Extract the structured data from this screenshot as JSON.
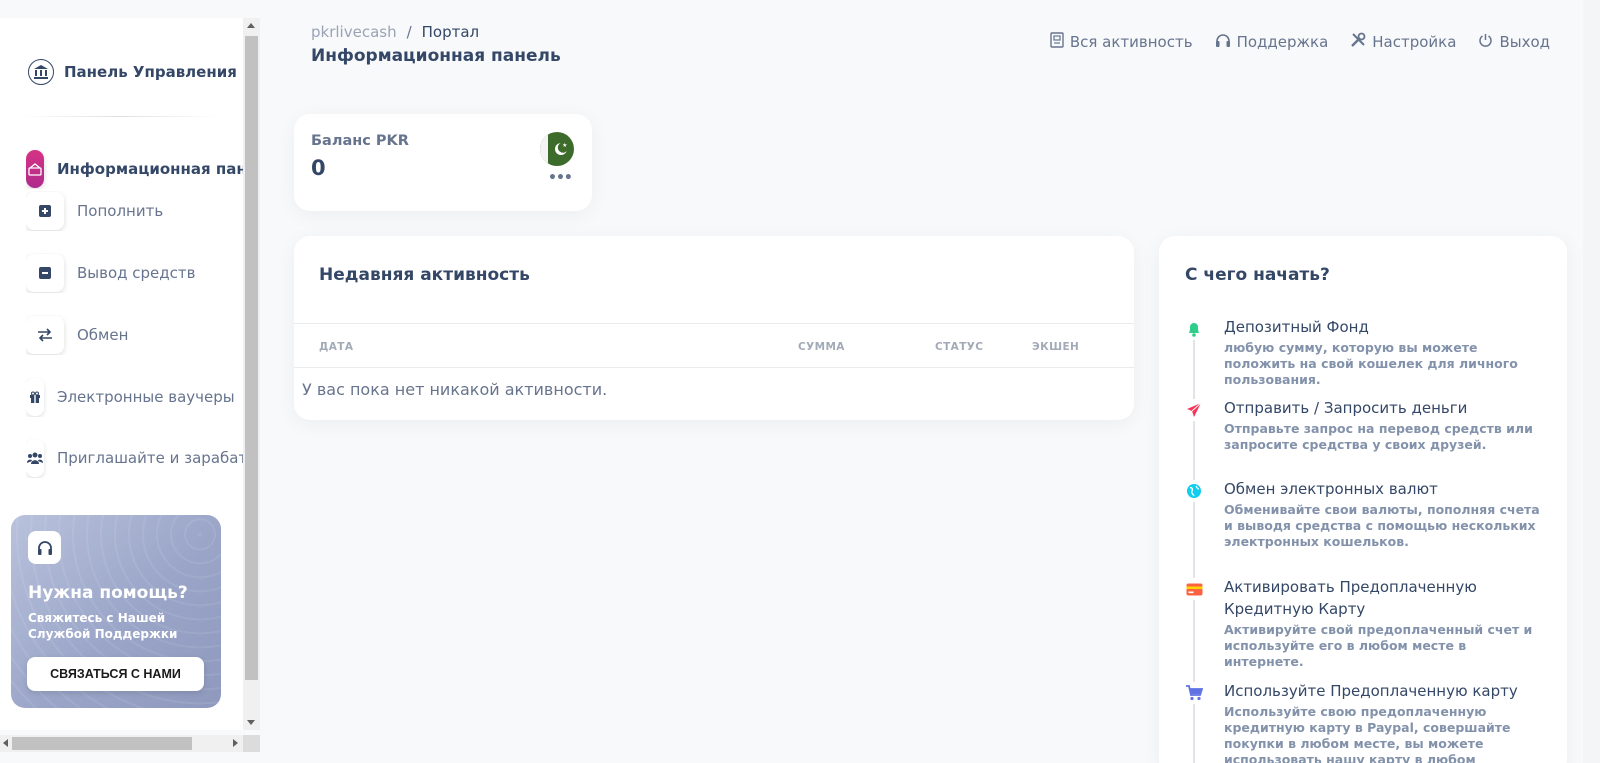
{
  "sidebar": {
    "brand": "Панель Управления pkrlivecash",
    "items": [
      {
        "label": "Информационная панель"
      },
      {
        "label": "Пополнить"
      },
      {
        "label": "Вывод средств"
      },
      {
        "label": "Обмен"
      },
      {
        "label": "Электронные ваучеры"
      },
      {
        "label": "Приглашайте и зарабатывайте"
      }
    ],
    "help": {
      "title": "Нужна помощь?",
      "subtitle": "Свяжитесь с Нашей Службой Поддержки",
      "button": "СВЯЗАТЬСЯ С НАМИ"
    }
  },
  "header": {
    "breadcrumb_root": "pkrlivecash",
    "breadcrumb_sep": "/",
    "breadcrumb_current": "Портал",
    "title": "Информационная панель",
    "nav": {
      "activity": "Вся активность",
      "support": "Поддержка",
      "settings": "Настройка",
      "logout": "Выход"
    }
  },
  "balance": {
    "label": "Баланс PKR",
    "value": "0",
    "more": "•••"
  },
  "activity": {
    "title": "Недавняя активность",
    "columns": [
      "ДАТА",
      "СУММА",
      "СТАТУС",
      "ЭКШЕН"
    ],
    "empty": "У вас пока нет никакой активности."
  },
  "getting_started": {
    "title": "С чего начать?",
    "items": [
      {
        "icon": "bell-icon",
        "color": "#2dce89",
        "title": "Депозитный Фонд",
        "desc": "любую сумму, которую вы можете положить на свой кошелек для личного пользования."
      },
      {
        "icon": "paper-plane-icon",
        "color": "#f5365c",
        "title": "Отправить / Запросить деньги",
        "desc": "Отправьте запрос на перевод средств или запросите средства у своих друзей."
      },
      {
        "icon": "globe-icon",
        "color": "#11cdef",
        "title": "Обмен электронных валют",
        "desc": "Обменивайте свои валюты, пополняя счета и выводя средства с помощью нескольких электронных кошельков."
      },
      {
        "icon": "credit-card-icon",
        "color": "#fb6340",
        "title": "Активировать Предоплаченную Кредитную Карту",
        "desc": "Активируйте свой предоплаченный счет и используйте его в любом месте в интернете."
      },
      {
        "icon": "cart-icon",
        "color": "#5e72e4",
        "title": "Используйте Предоплаченную карту",
        "desc": "Используйте свою предоплаченную кредитную карту в Paypal, совершайте покупки в любом месте, вы можете использовать нашу карту в любом интернет-магазине, где принимаются"
      }
    ]
  }
}
